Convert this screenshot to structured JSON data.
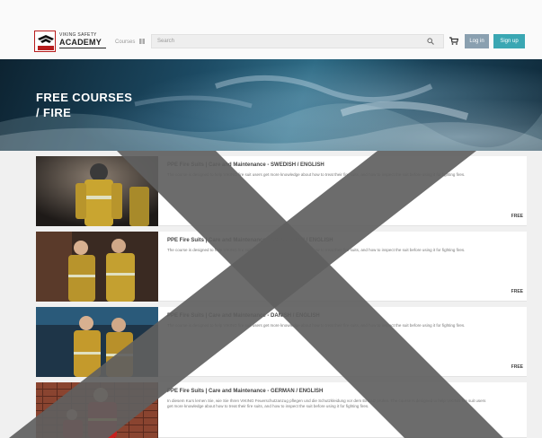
{
  "header": {
    "logo_line1": "VIKING SAFETY",
    "logo_line2": "ACADEMY",
    "browse_label": "Courses",
    "search_placeholder": "Search",
    "login_label": "Log in",
    "signup_label": "Sign up"
  },
  "hero": {
    "title_line1": "FREE COURSES",
    "title_line2": "/ FIRE"
  },
  "courses": [
    {
      "title": "PPE Fire Suits | Care and Maintenance - SWEDISH / ENGLISH",
      "desc": "The course is designed to help VIKING fire suit users get more knowledge about how to treat their fire suits, and how to inspect the suit before using it for fighting fires.",
      "price": "FREE"
    },
    {
      "title": "PPE Fire Suits | Care and Maintenance - NORWEGIAN / ENGLISH",
      "desc": "The course is designed to help VIKING fire suit users get more knowledge about how to treat their fire suits, and how to inspect the suit before using it for fighting fires.",
      "price": "FREE"
    },
    {
      "title": "PPE Fire Suits | Care and Maintenance - DANISH / ENGLISH",
      "desc": "The course is designed to help VIKING fire suit users get more knowledge about how to treat their fire suits, and how to inspect the suit before using it for fighting fires.",
      "price": "FREE"
    },
    {
      "title": "PPE Fire Suits | Care and Maintenance - GERMAN / ENGLISH",
      "desc": "In diesem Kurs lernen Sie, wie Sie Ihren VIKING Feuerschutzanzug pflegen und die Schutzkleidung vor dem Einsatz prüfen. The course is designed to help VIKING fire suit users get more knowledge about how to treat their fire suits, and how to inspect the suit before using it for fighting fires.",
      "price": ""
    }
  ],
  "colors": {
    "login": "#8aa0b0",
    "signup": "#3aa7b3",
    "brand_red": "#b71c1c",
    "watermark": "#5f5f5f"
  }
}
